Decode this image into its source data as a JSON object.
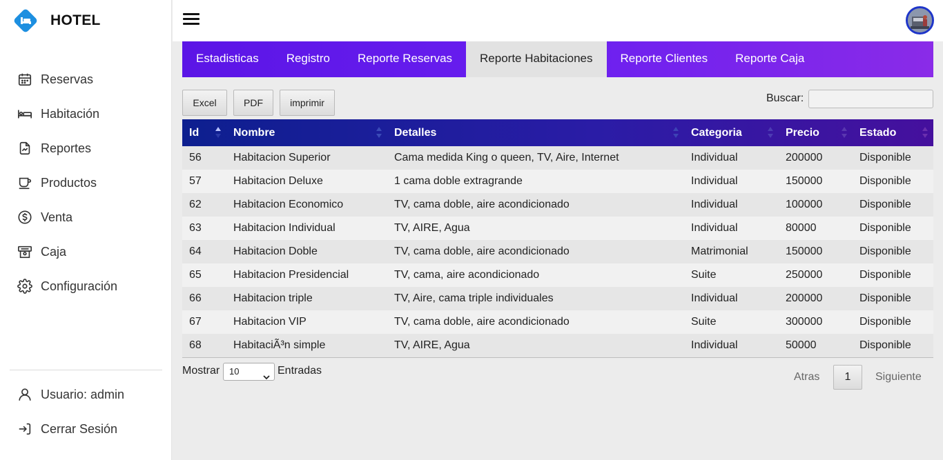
{
  "brand": {
    "title": "HOTEL",
    "logo_icon": "bed-diamond-icon",
    "logo_color": "#1d8fe0"
  },
  "sidebar": {
    "items": [
      {
        "label": "Reservas",
        "icon": "calendar-icon"
      },
      {
        "label": "Habitación",
        "icon": "bed-icon"
      },
      {
        "label": "Reportes",
        "icon": "report-icon"
      },
      {
        "label": "Productos",
        "icon": "cup-icon"
      },
      {
        "label": "Venta",
        "icon": "dollar-circle-icon"
      },
      {
        "label": "Caja",
        "icon": "cash-register-icon"
      },
      {
        "label": "Configuración",
        "icon": "gear-icon"
      }
    ],
    "bottom": [
      {
        "label": "Usuario: admin",
        "icon": "user-icon"
      },
      {
        "label": "Cerrar Sesión",
        "icon": "logout-icon"
      }
    ]
  },
  "tabs": [
    {
      "label": "Estadisticas",
      "active": false
    },
    {
      "label": "Registro",
      "active": false
    },
    {
      "label": "Reporte Reservas",
      "active": false
    },
    {
      "label": "Reporte Habitaciones",
      "active": true
    },
    {
      "label": "Reporte Clientes",
      "active": false
    },
    {
      "label": "Reporte Caja",
      "active": false
    }
  ],
  "toolbar": {
    "excel_label": "Excel",
    "pdf_label": "PDF",
    "print_label": "imprimir",
    "search_label": "Buscar:",
    "search_value": ""
  },
  "table": {
    "columns": [
      "Id",
      "Nombre",
      "Detalles",
      "Categoria",
      "Precio",
      "Estado"
    ],
    "sorted_column": "Id",
    "rows": [
      [
        "56",
        "Habitacion Superior",
        "Cama medida King o queen, TV, Aire, Internet",
        "Individual",
        "200000",
        "Disponible"
      ],
      [
        "57",
        "Habitacion Deluxe",
        "1 cama doble extragrande",
        "Individual",
        "150000",
        "Disponible"
      ],
      [
        "62",
        "Habitacion Economico",
        "TV, cama doble, aire acondicionado",
        "Individual",
        "100000",
        "Disponible"
      ],
      [
        "63",
        "Habitacion Individual",
        "TV, AIRE, Agua",
        "Individual",
        "80000",
        "Disponible"
      ],
      [
        "64",
        "Habitacion Doble",
        "TV, cama doble, aire acondicionado",
        "Matrimonial",
        "150000",
        "Disponible"
      ],
      [
        "65",
        "Habitacion Presidencial",
        "TV, cama, aire acondicionado",
        "Suite",
        "250000",
        "Disponible"
      ],
      [
        "66",
        "Habitacion triple",
        "TV, Aire, cama triple individuales",
        "Individual",
        "200000",
        "Disponible"
      ],
      [
        "67",
        "Habitacion VIP",
        "TV, cama doble, aire acondicionado",
        "Suite",
        "300000",
        "Disponible"
      ],
      [
        "68",
        "HabitaciÃ³n simple",
        "TV, AIRE, Agua",
        "Individual",
        "50000",
        "Disponible"
      ]
    ]
  },
  "footer": {
    "show_label": "Mostrar",
    "page_size": "10",
    "entries_label": "Entradas",
    "prev_label": "Atras",
    "current_page": "1",
    "next_label": "Siguiente"
  },
  "colors": {
    "tabs_gradient_start": "#5b15e6",
    "tabs_gradient_end": "#8a2be8",
    "header_gradient_start": "#0d1f8f",
    "header_gradient_end": "#45109d",
    "avatar_border": "#1e35c9"
  }
}
